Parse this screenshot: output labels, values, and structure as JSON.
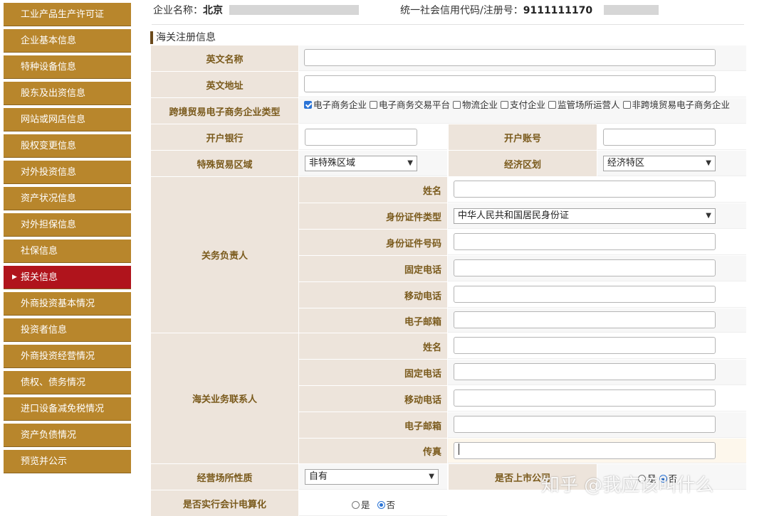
{
  "sidebar": {
    "items": [
      {
        "label": "工业产品生产许可证"
      },
      {
        "label": "企业基本信息"
      },
      {
        "label": "特种设备信息"
      },
      {
        "label": "股东及出资信息"
      },
      {
        "label": "网站或网店信息"
      },
      {
        "label": "股权变更信息"
      },
      {
        "label": "对外投资信息"
      },
      {
        "label": "资产状况信息"
      },
      {
        "label": "对外担保信息"
      },
      {
        "label": "社保信息"
      },
      {
        "label": "报关信息",
        "active": true
      },
      {
        "label": "外商投资基本情况"
      },
      {
        "label": "投资者信息"
      },
      {
        "label": "外商投资经营情况"
      },
      {
        "label": "债权、债务情况"
      },
      {
        "label": "进口设备减免税情况"
      },
      {
        "label": "资产负债情况"
      },
      {
        "label": "预览并公示"
      }
    ]
  },
  "header": {
    "company_label": "企业名称：",
    "company_value": "北京",
    "credit_label": "统一社会信用代码/注册号：",
    "credit_value": "9111111170"
  },
  "section_title": "海关注册信息",
  "form": {
    "english_name_label": "英文名称",
    "english_name_value": "",
    "english_address_label": "英文地址",
    "english_address_value": "",
    "ecommerce_type_label": "跨境贸易电子商务企业类型",
    "ecommerce_types": [
      {
        "label": "电子商务企业",
        "checked": true
      },
      {
        "label": "电子商务交易平台",
        "checked": false
      },
      {
        "label": "物流企业",
        "checked": false
      },
      {
        "label": "支付企业",
        "checked": false
      },
      {
        "label": "监管场所运营人",
        "checked": false
      },
      {
        "label": "非跨境贸易电子商务企业",
        "checked": false
      }
    ],
    "bank_label": "开户银行",
    "bank_value": "",
    "account_label": "开户账号",
    "account_value": "",
    "special_zone_label": "特殊贸易区域",
    "special_zone_value": "非特殊区域",
    "econ_zone_label": "经济区划",
    "econ_zone_value": "经济特区",
    "customs_head_label": "关务负责人",
    "customs_head_fields": [
      {
        "label": "姓名",
        "type": "input",
        "value": ""
      },
      {
        "label": "身份证件类型",
        "type": "select",
        "value": "中华人民共和国居民身份证"
      },
      {
        "label": "身份证件号码",
        "type": "input",
        "value": ""
      },
      {
        "label": "固定电话",
        "type": "input",
        "value": ""
      },
      {
        "label": "移动电话",
        "type": "input",
        "value": ""
      },
      {
        "label": "电子邮箱",
        "type": "input",
        "value": ""
      }
    ],
    "customs_contact_label": "海关业务联系人",
    "customs_contact_fields": [
      {
        "label": "姓名",
        "value": ""
      },
      {
        "label": "固定电话",
        "value": ""
      },
      {
        "label": "移动电话",
        "value": ""
      },
      {
        "label": "电子邮箱",
        "value": ""
      },
      {
        "label": "传真",
        "value": ""
      }
    ],
    "premises_label": "经营场所性质",
    "premises_value": "自有",
    "listed_label": "是否上市公司",
    "listed_yes": "是",
    "listed_no": "否",
    "accounting_label": "是否实行会计电算化",
    "accounting_yes": "是",
    "accounting_no": "否",
    "accounting_value": "否"
  },
  "watermark": "知乎 @我应该叫什么",
  "colors": {
    "sidebar": "#b8862c",
    "sidebar_active": "#b0141c",
    "label_bg": "#ede4db",
    "label_text": "#7a5a1c"
  }
}
